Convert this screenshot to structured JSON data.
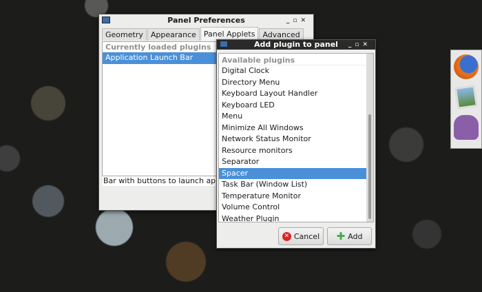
{
  "prefs": {
    "title": "Panel Preferences",
    "tabs": [
      "Geometry",
      "Appearance",
      "Panel Applets",
      "Advanced"
    ],
    "active_tab": "Panel Applets",
    "list_header": "Currently loaded plugins",
    "items": [
      "Application Launch Bar"
    ],
    "selected": "Application Launch Bar",
    "description": "Bar with buttons to launch applicati"
  },
  "dialog": {
    "title": "Add plugin to panel",
    "list_header": "Available plugins",
    "items": [
      "Digital Clock",
      "Directory Menu",
      "Keyboard Layout Handler",
      "Keyboard LED",
      "Menu",
      "Minimize All Windows",
      "Network Status Monitor",
      "Resource monitors",
      "Separator",
      "Spacer",
      "Task Bar (Window List)",
      "Temperature Monitor",
      "Volume Control",
      "Weather Plugin"
    ],
    "selected": "Spacer",
    "cancel_label": "Cancel",
    "add_label": "Add"
  },
  "dock": {
    "icons": [
      "firefox-icon",
      "image-viewer-icon",
      "pidgin-icon"
    ]
  },
  "colors": {
    "selection": "#4a90d9"
  }
}
